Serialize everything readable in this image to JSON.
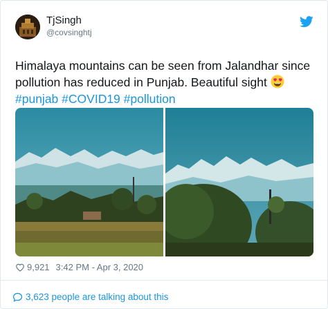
{
  "header": {
    "name": "TjSingh",
    "handle": "@covsinghtj"
  },
  "tweet": {
    "text": "Himalaya mountains can be seen from Jalandhar since pollution has reduced in Punjab. Beautiful sight",
    "emoji": "heart-eyes-emoji",
    "hashtags": [
      "#punjab",
      "#COVID19",
      "#pollution"
    ]
  },
  "meta": {
    "likes": "9,921",
    "timestamp": "3:42 PM - Apr 3, 2020"
  },
  "footer": {
    "talking": "3,623 people are talking about this"
  },
  "colors": {
    "link": "#1b95e0",
    "muted": "#657786",
    "text": "#14171a",
    "sky": "#2a8aa0"
  },
  "icons": [
    "twitter-bird-icon",
    "heart-icon",
    "speech-bubble-icon"
  ]
}
